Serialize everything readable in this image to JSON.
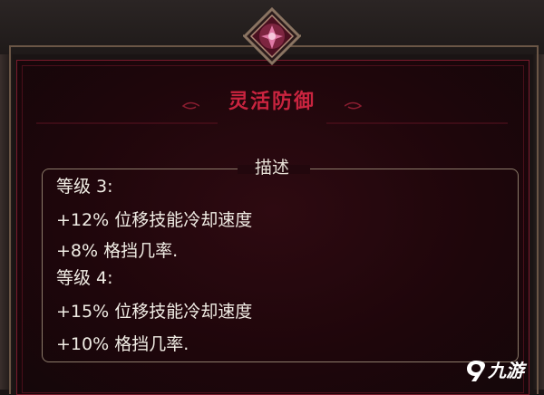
{
  "skill": {
    "title": "灵活防御",
    "section_label": "描述",
    "lines": [
      "等级 3:",
      "+12% 位移技能冷却速度",
      "+8% 格挡几率.",
      "等级 4:",
      "+15% 位移技能冷却速度",
      "+10% 格挡几率."
    ]
  },
  "watermark": {
    "text": "九游",
    "icon": "9game-logo-icon"
  },
  "colors": {
    "title": "#c9243f",
    "panel": "#1f060b",
    "frame": "#6b5646",
    "text": "#f0ece4"
  },
  "emblem_icon": "skill-emblem-icon"
}
